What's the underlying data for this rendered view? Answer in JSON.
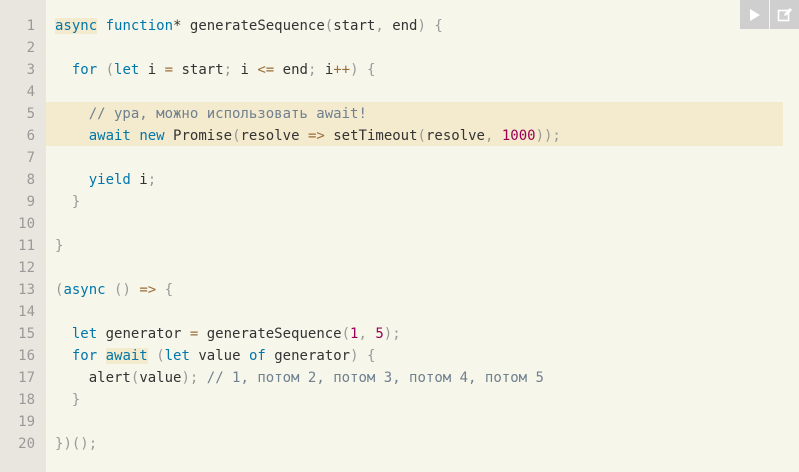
{
  "toolbar": {
    "run_icon": "play-icon",
    "edit_icon": "edit-icon"
  },
  "highlighted_lines": [
    5,
    6
  ],
  "lines": [
    {
      "number": "1",
      "tokens": [
        {
          "t": "async",
          "k": "kw",
          "mark": true
        },
        {
          "t": " ",
          "k": "plain"
        },
        {
          "t": "function",
          "k": "kw"
        },
        {
          "t": "* ",
          "k": "plain"
        },
        {
          "t": "generateSequence",
          "k": "plain"
        },
        {
          "t": "(",
          "k": "punct"
        },
        {
          "t": "start",
          "k": "plain"
        },
        {
          "t": ", ",
          "k": "punct"
        },
        {
          "t": "end",
          "k": "plain"
        },
        {
          "t": ")",
          "k": "punct"
        },
        {
          "t": " ",
          "k": "plain"
        },
        {
          "t": "{",
          "k": "punct"
        }
      ]
    },
    {
      "number": "2",
      "tokens": []
    },
    {
      "number": "3",
      "tokens": [
        {
          "t": "  ",
          "k": "plain"
        },
        {
          "t": "for",
          "k": "kw"
        },
        {
          "t": " ",
          "k": "plain"
        },
        {
          "t": "(",
          "k": "punct"
        },
        {
          "t": "let",
          "k": "kw"
        },
        {
          "t": " i ",
          "k": "plain"
        },
        {
          "t": "=",
          "k": "op"
        },
        {
          "t": " start",
          "k": "plain"
        },
        {
          "t": ";",
          "k": "punct"
        },
        {
          "t": " i ",
          "k": "plain"
        },
        {
          "t": "<=",
          "k": "op"
        },
        {
          "t": " end",
          "k": "plain"
        },
        {
          "t": ";",
          "k": "punct"
        },
        {
          "t": " i",
          "k": "plain"
        },
        {
          "t": "++",
          "k": "op"
        },
        {
          "t": ")",
          "k": "punct"
        },
        {
          "t": " ",
          "k": "plain"
        },
        {
          "t": "{",
          "k": "punct"
        }
      ]
    },
    {
      "number": "4",
      "tokens": []
    },
    {
      "number": "5",
      "tokens": [
        {
          "t": "    ",
          "k": "plain"
        },
        {
          "t": "// ура, можно использовать await!",
          "k": "cmt"
        }
      ]
    },
    {
      "number": "6",
      "tokens": [
        {
          "t": "    ",
          "k": "plain"
        },
        {
          "t": "await",
          "k": "kw"
        },
        {
          "t": " ",
          "k": "plain"
        },
        {
          "t": "new",
          "k": "kw"
        },
        {
          "t": " ",
          "k": "plain"
        },
        {
          "t": "Promise",
          "k": "plain"
        },
        {
          "t": "(",
          "k": "punct"
        },
        {
          "t": "resolve",
          "k": "plain"
        },
        {
          "t": " ",
          "k": "plain"
        },
        {
          "t": "=>",
          "k": "op"
        },
        {
          "t": " ",
          "k": "plain"
        },
        {
          "t": "setTimeout",
          "k": "plain"
        },
        {
          "t": "(",
          "k": "punct"
        },
        {
          "t": "resolve",
          "k": "plain"
        },
        {
          "t": ", ",
          "k": "punct"
        },
        {
          "t": "1000",
          "k": "num"
        },
        {
          "t": "));",
          "k": "punct"
        }
      ]
    },
    {
      "number": "7",
      "tokens": []
    },
    {
      "number": "8",
      "tokens": [
        {
          "t": "    ",
          "k": "plain"
        },
        {
          "t": "yield",
          "k": "kw"
        },
        {
          "t": " i",
          "k": "plain"
        },
        {
          "t": ";",
          "k": "punct"
        }
      ]
    },
    {
      "number": "9",
      "tokens": [
        {
          "t": "  ",
          "k": "plain"
        },
        {
          "t": "}",
          "k": "punct"
        }
      ]
    },
    {
      "number": "10",
      "tokens": []
    },
    {
      "number": "11",
      "tokens": [
        {
          "t": "}",
          "k": "punct"
        }
      ]
    },
    {
      "number": "12",
      "tokens": []
    },
    {
      "number": "13",
      "tokens": [
        {
          "t": "(",
          "k": "punct"
        },
        {
          "t": "async",
          "k": "kw"
        },
        {
          "t": " ",
          "k": "plain"
        },
        {
          "t": "()",
          "k": "punct"
        },
        {
          "t": " ",
          "k": "plain"
        },
        {
          "t": "=>",
          "k": "op"
        },
        {
          "t": " ",
          "k": "plain"
        },
        {
          "t": "{",
          "k": "punct"
        }
      ]
    },
    {
      "number": "14",
      "tokens": []
    },
    {
      "number": "15",
      "tokens": [
        {
          "t": "  ",
          "k": "plain"
        },
        {
          "t": "let",
          "k": "kw"
        },
        {
          "t": " generator ",
          "k": "plain"
        },
        {
          "t": "=",
          "k": "op"
        },
        {
          "t": " generateSequence",
          "k": "plain"
        },
        {
          "t": "(",
          "k": "punct"
        },
        {
          "t": "1",
          "k": "num"
        },
        {
          "t": ", ",
          "k": "punct"
        },
        {
          "t": "5",
          "k": "num"
        },
        {
          "t": ");",
          "k": "punct"
        }
      ]
    },
    {
      "number": "16",
      "tokens": [
        {
          "t": "  ",
          "k": "plain"
        },
        {
          "t": "for",
          "k": "kw"
        },
        {
          "t": " ",
          "k": "plain"
        },
        {
          "t": "await",
          "k": "kw",
          "mark": true
        },
        {
          "t": " ",
          "k": "plain"
        },
        {
          "t": "(",
          "k": "punct"
        },
        {
          "t": "let",
          "k": "kw"
        },
        {
          "t": " value ",
          "k": "plain"
        },
        {
          "t": "of",
          "k": "kw"
        },
        {
          "t": " generator",
          "k": "plain"
        },
        {
          "t": ")",
          "k": "punct"
        },
        {
          "t": " ",
          "k": "plain"
        },
        {
          "t": "{",
          "k": "punct"
        }
      ]
    },
    {
      "number": "17",
      "tokens": [
        {
          "t": "    ",
          "k": "plain"
        },
        {
          "t": "alert",
          "k": "plain"
        },
        {
          "t": "(",
          "k": "punct"
        },
        {
          "t": "value",
          "k": "plain"
        },
        {
          "t": ");",
          "k": "punct"
        },
        {
          "t": " ",
          "k": "plain"
        },
        {
          "t": "// 1, потом 2, потом 3, потом 4, потом 5",
          "k": "cmt"
        }
      ]
    },
    {
      "number": "18",
      "tokens": [
        {
          "t": "  ",
          "k": "plain"
        },
        {
          "t": "}",
          "k": "punct"
        }
      ]
    },
    {
      "number": "19",
      "tokens": []
    },
    {
      "number": "20",
      "tokens": [
        {
          "t": "}",
          "k": "punct"
        },
        {
          "t": ")();",
          "k": "punct"
        }
      ]
    }
  ]
}
